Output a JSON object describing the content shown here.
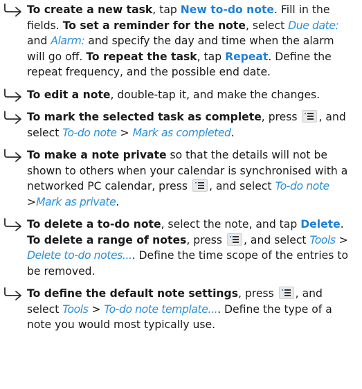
{
  "items": [
    {
      "segments": [
        {
          "t": "To create a new task",
          "s": "b"
        },
        {
          "t": ", tap ",
          "s": ""
        },
        {
          "t": "New to-do note",
          "s": "bl"
        },
        {
          "t": ". Fill in the fields. ",
          "s": ""
        },
        {
          "t": "To set a reminder for the note",
          "s": "b"
        },
        {
          "t": ", select ",
          "s": ""
        },
        {
          "t": "Due date:",
          "s": "it"
        },
        {
          "t": " and ",
          "s": ""
        },
        {
          "t": "Alarm:",
          "s": "it"
        },
        {
          "t": " and specify the day and time when the alarm will go off. ",
          "s": ""
        },
        {
          "t": "To repeat the task",
          "s": "b"
        },
        {
          "t": ", tap ",
          "s": ""
        },
        {
          "t": "Repeat",
          "s": "bl"
        },
        {
          "t": ". Define the repeat frequency, and the possible end date.",
          "s": ""
        }
      ]
    },
    {
      "segments": [
        {
          "t": "To edit a note",
          "s": "b"
        },
        {
          "t": ", double-tap it, and make the changes.",
          "s": ""
        }
      ]
    },
    {
      "segments": [
        {
          "t": "To mark the selected task as complete",
          "s": "b"
        },
        {
          "t": ", press ",
          "s": ""
        },
        {
          "t": "",
          "s": "key"
        },
        {
          "t": ", and select ",
          "s": ""
        },
        {
          "t": "To-do note",
          "s": "it"
        },
        {
          "t": " > ",
          "s": ""
        },
        {
          "t": "Mark as completed",
          "s": "it"
        },
        {
          "t": ".",
          "s": ""
        }
      ]
    },
    {
      "segments": [
        {
          "t": "To make a note private",
          "s": "b"
        },
        {
          "t": " so that the details will not be shown to others when your calendar is synchronised with a networked PC calendar, press ",
          "s": ""
        },
        {
          "t": "",
          "s": "key"
        },
        {
          "t": ", and select ",
          "s": ""
        },
        {
          "t": "To-do note",
          "s": "it"
        },
        {
          "t": " >",
          "s": ""
        },
        {
          "t": "Mark as private",
          "s": "it"
        },
        {
          "t": ".",
          "s": ""
        }
      ]
    },
    {
      "segments": [
        {
          "t": "To delete a to-do note",
          "s": "b"
        },
        {
          "t": ", select the note, and tap ",
          "s": ""
        },
        {
          "t": "Delete",
          "s": "bl"
        },
        {
          "t": ". ",
          "s": ""
        },
        {
          "t": "To delete a range of notes",
          "s": "b"
        },
        {
          "t": ", press ",
          "s": ""
        },
        {
          "t": "",
          "s": "key"
        },
        {
          "t": ", and select ",
          "s": ""
        },
        {
          "t": "Tools",
          "s": "it"
        },
        {
          "t": " > ",
          "s": ""
        },
        {
          "t": "Delete to-do notes...",
          "s": "it"
        },
        {
          "t": ". Define the time scope of the entries to be removed.",
          "s": ""
        }
      ]
    },
    {
      "segments": [
        {
          "t": "To define the default note settings",
          "s": "b"
        },
        {
          "t": ", press ",
          "s": ""
        },
        {
          "t": "",
          "s": "key"
        },
        {
          "t": ", and select ",
          "s": ""
        },
        {
          "t": "Tools",
          "s": "it"
        },
        {
          "t": " > ",
          "s": ""
        },
        {
          "t": "To-do note template...",
          "s": "it"
        },
        {
          "t": ". Define the type of a note you would most typically use.",
          "s": ""
        }
      ]
    }
  ],
  "icons": {
    "bullet": "hooked-arrow-icon",
    "key": "menu-key-icon"
  },
  "colors": {
    "text": "#1a1a1a",
    "command": "#1f7fd6",
    "menu_path": "#2b8fd9",
    "key_bg": "#e9e9e9"
  }
}
